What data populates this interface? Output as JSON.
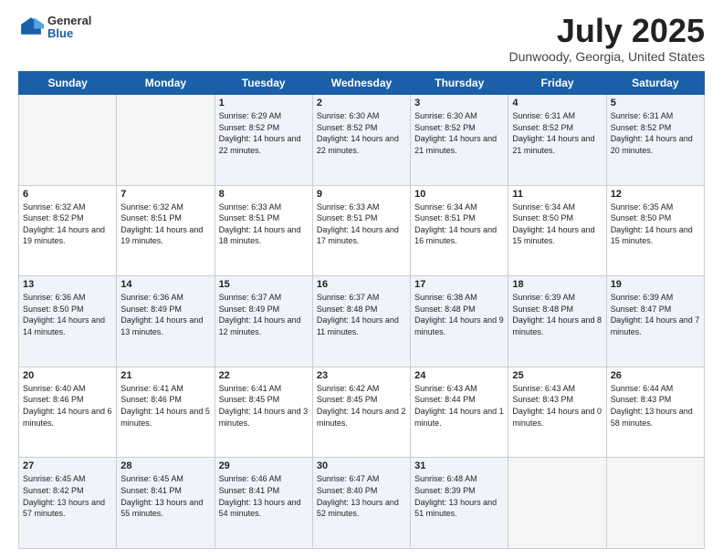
{
  "header": {
    "logo": {
      "general": "General",
      "blue": "Blue"
    },
    "title": "July 2025",
    "location": "Dunwoody, Georgia, United States"
  },
  "weekdays": [
    "Sunday",
    "Monday",
    "Tuesday",
    "Wednesday",
    "Thursday",
    "Friday",
    "Saturday"
  ],
  "weeks": [
    [
      {
        "day": null
      },
      {
        "day": null
      },
      {
        "day": "1",
        "sunrise": "6:29 AM",
        "sunset": "8:52 PM",
        "daylight": "14 hours and 22 minutes."
      },
      {
        "day": "2",
        "sunrise": "6:30 AM",
        "sunset": "8:52 PM",
        "daylight": "14 hours and 22 minutes."
      },
      {
        "day": "3",
        "sunrise": "6:30 AM",
        "sunset": "8:52 PM",
        "daylight": "14 hours and 21 minutes."
      },
      {
        "day": "4",
        "sunrise": "6:31 AM",
        "sunset": "8:52 PM",
        "daylight": "14 hours and 21 minutes."
      },
      {
        "day": "5",
        "sunrise": "6:31 AM",
        "sunset": "8:52 PM",
        "daylight": "14 hours and 20 minutes."
      }
    ],
    [
      {
        "day": "6",
        "sunrise": "6:32 AM",
        "sunset": "8:52 PM",
        "daylight": "14 hours and 19 minutes."
      },
      {
        "day": "7",
        "sunrise": "6:32 AM",
        "sunset": "8:51 PM",
        "daylight": "14 hours and 19 minutes."
      },
      {
        "day": "8",
        "sunrise": "6:33 AM",
        "sunset": "8:51 PM",
        "daylight": "14 hours and 18 minutes."
      },
      {
        "day": "9",
        "sunrise": "6:33 AM",
        "sunset": "8:51 PM",
        "daylight": "14 hours and 17 minutes."
      },
      {
        "day": "10",
        "sunrise": "6:34 AM",
        "sunset": "8:51 PM",
        "daylight": "14 hours and 16 minutes."
      },
      {
        "day": "11",
        "sunrise": "6:34 AM",
        "sunset": "8:50 PM",
        "daylight": "14 hours and 15 minutes."
      },
      {
        "day": "12",
        "sunrise": "6:35 AM",
        "sunset": "8:50 PM",
        "daylight": "14 hours and 15 minutes."
      }
    ],
    [
      {
        "day": "13",
        "sunrise": "6:36 AM",
        "sunset": "8:50 PM",
        "daylight": "14 hours and 14 minutes."
      },
      {
        "day": "14",
        "sunrise": "6:36 AM",
        "sunset": "8:49 PM",
        "daylight": "14 hours and 13 minutes."
      },
      {
        "day": "15",
        "sunrise": "6:37 AM",
        "sunset": "8:49 PM",
        "daylight": "14 hours and 12 minutes."
      },
      {
        "day": "16",
        "sunrise": "6:37 AM",
        "sunset": "8:48 PM",
        "daylight": "14 hours and 11 minutes."
      },
      {
        "day": "17",
        "sunrise": "6:38 AM",
        "sunset": "8:48 PM",
        "daylight": "14 hours and 9 minutes."
      },
      {
        "day": "18",
        "sunrise": "6:39 AM",
        "sunset": "8:48 PM",
        "daylight": "14 hours and 8 minutes."
      },
      {
        "day": "19",
        "sunrise": "6:39 AM",
        "sunset": "8:47 PM",
        "daylight": "14 hours and 7 minutes."
      }
    ],
    [
      {
        "day": "20",
        "sunrise": "6:40 AM",
        "sunset": "8:46 PM",
        "daylight": "14 hours and 6 minutes."
      },
      {
        "day": "21",
        "sunrise": "6:41 AM",
        "sunset": "8:46 PM",
        "daylight": "14 hours and 5 minutes."
      },
      {
        "day": "22",
        "sunrise": "6:41 AM",
        "sunset": "8:45 PM",
        "daylight": "14 hours and 3 minutes."
      },
      {
        "day": "23",
        "sunrise": "6:42 AM",
        "sunset": "8:45 PM",
        "daylight": "14 hours and 2 minutes."
      },
      {
        "day": "24",
        "sunrise": "6:43 AM",
        "sunset": "8:44 PM",
        "daylight": "14 hours and 1 minute."
      },
      {
        "day": "25",
        "sunrise": "6:43 AM",
        "sunset": "8:43 PM",
        "daylight": "14 hours and 0 minutes."
      },
      {
        "day": "26",
        "sunrise": "6:44 AM",
        "sunset": "8:43 PM",
        "daylight": "13 hours and 58 minutes."
      }
    ],
    [
      {
        "day": "27",
        "sunrise": "6:45 AM",
        "sunset": "8:42 PM",
        "daylight": "13 hours and 57 minutes."
      },
      {
        "day": "28",
        "sunrise": "6:45 AM",
        "sunset": "8:41 PM",
        "daylight": "13 hours and 55 minutes."
      },
      {
        "day": "29",
        "sunrise": "6:46 AM",
        "sunset": "8:41 PM",
        "daylight": "13 hours and 54 minutes."
      },
      {
        "day": "30",
        "sunrise": "6:47 AM",
        "sunset": "8:40 PM",
        "daylight": "13 hours and 52 minutes."
      },
      {
        "day": "31",
        "sunrise": "6:48 AM",
        "sunset": "8:39 PM",
        "daylight": "13 hours and 51 minutes."
      },
      {
        "day": null
      },
      {
        "day": null
      }
    ]
  ]
}
